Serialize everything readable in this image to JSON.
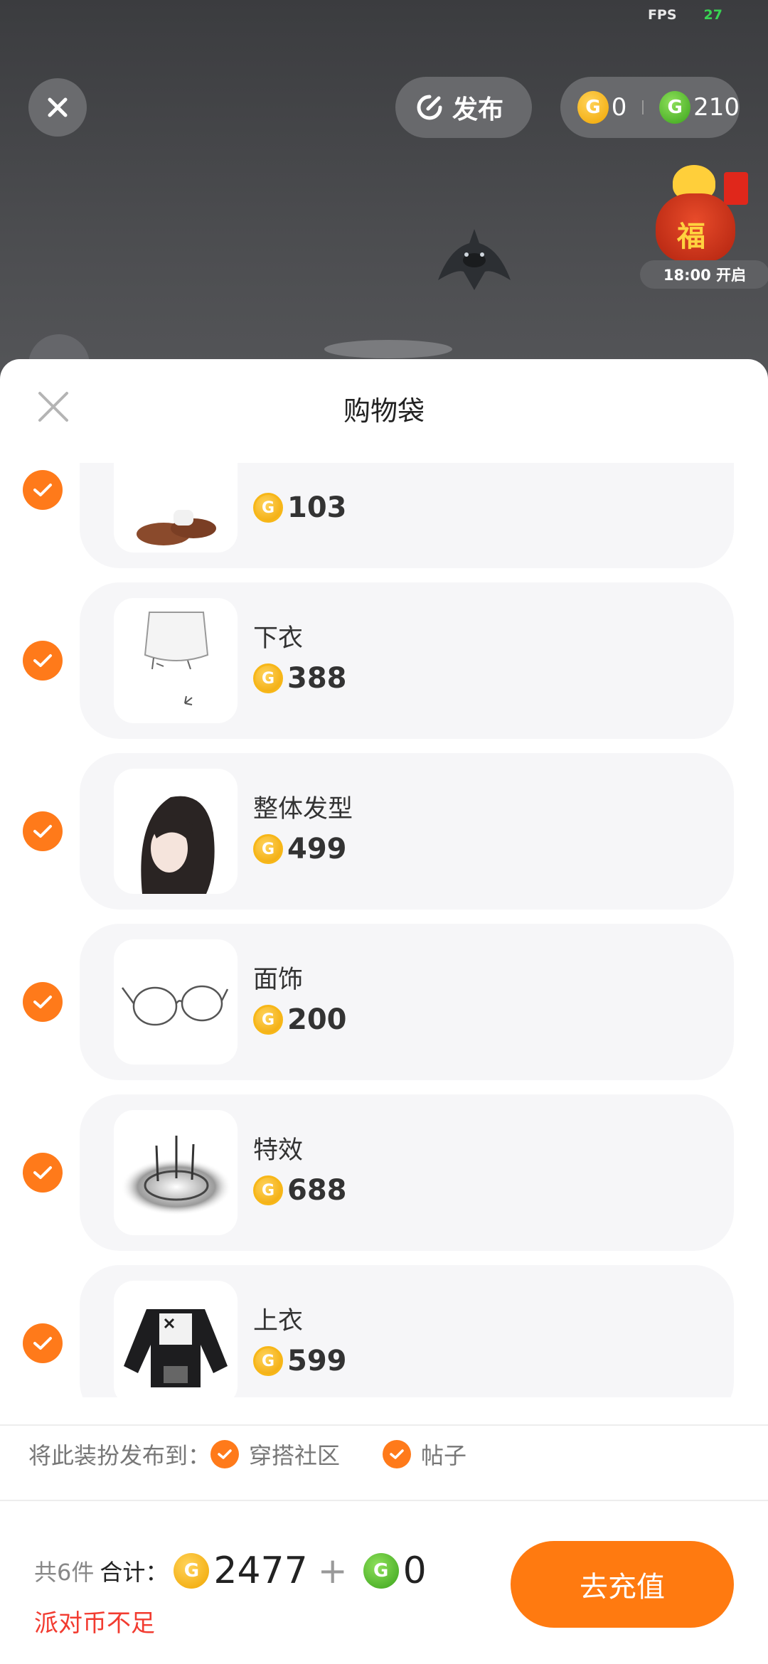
{
  "hud": {
    "fps_label": "FPS",
    "fps_value": "27",
    "publish_label": "发布",
    "gold_balance": "0",
    "green_balance": "210",
    "event_time": "18:00 开启"
  },
  "sheet": {
    "title": "购物袋",
    "items": [
      {
        "name": "",
        "price": "103",
        "checked": true,
        "icon": "shoes-icon"
      },
      {
        "name": "下衣",
        "price": "388",
        "checked": true,
        "icon": "skirt-icon"
      },
      {
        "name": "整体发型",
        "price": "499",
        "checked": true,
        "icon": "hairstyle-icon"
      },
      {
        "name": "面饰",
        "price": "200",
        "checked": true,
        "icon": "glasses-icon"
      },
      {
        "name": "特效",
        "price": "688",
        "checked": true,
        "icon": "effect-icon"
      },
      {
        "name": "上衣",
        "price": "599",
        "checked": true,
        "icon": "jacket-icon"
      }
    ],
    "publish_to_label": "将此装扮发布到：",
    "publish_options": [
      {
        "label": "穿搭社区",
        "checked": true
      },
      {
        "label": "帖子",
        "checked": true
      }
    ]
  },
  "footer": {
    "count_label": "共6件",
    "total_label": "合计：",
    "gold_total": "2477",
    "plus": "+",
    "green_total": "0",
    "warning": "派对币不足",
    "recharge_label": "去充值"
  },
  "colors": {
    "accent": "#ff7a10",
    "warning": "#f23b30",
    "gold": "#f7b718",
    "green": "#3aa31b"
  }
}
